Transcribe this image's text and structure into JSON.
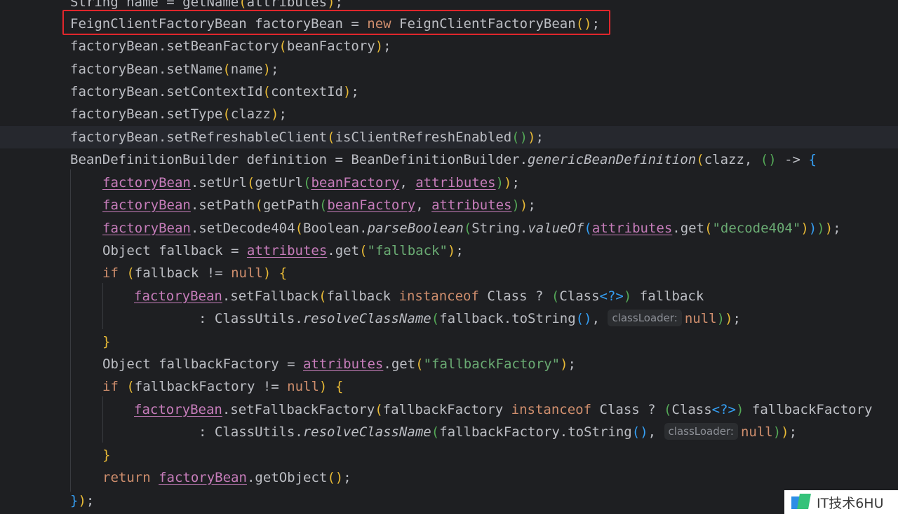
{
  "code": {
    "line0": "String name = getName(attributes);",
    "line1": "FeignClientFactoryBean factoryBean = new FeignClientFactoryBean();",
    "line2": "factoryBean.setBeanFactory(beanFactory);",
    "line3": "factoryBean.setName(name);",
    "line4": "factoryBean.setContextId(contextId);",
    "line5": "factoryBean.setType(clazz);",
    "line6": "factoryBean.setRefreshableClient(isClientRefreshEnabled());",
    "line7": "BeanDefinitionBuilder definition = BeanDefinitionBuilder.genericBeanDefinition(clazz, () -> {",
    "line8": "factoryBean.setUrl(getUrl(beanFactory, attributes));",
    "line9": "factoryBean.setPath(getPath(beanFactory, attributes));",
    "line10": "factoryBean.setDecode404(Boolean.parseBoolean(String.valueOf(attributes.get(\"decode404\"))));",
    "line11": "Object fallback = attributes.get(\"fallback\");",
    "line12": "if (fallback != null) {",
    "line13": "factoryBean.setFallback(fallback instanceof Class ? (Class<?>) fallback",
    "line14": ": ClassUtils.resolveClassName(fallback.toString(), classLoader: null));",
    "line15": "}",
    "line16": "Object fallbackFactory = attributes.get(\"fallbackFactory\");",
    "line17": "if (fallbackFactory != null) {",
    "line18": "factoryBean.setFallbackFactory(fallbackFactory instanceof Class ? (Class<?>) fallbackFactory",
    "line19": ": ClassUtils.resolveClassName(fallbackFactory.toString(), classLoader: null));",
    "line20": "}",
    "line21": "return factoryBean.getObject();",
    "line22": "});"
  },
  "hints": {
    "classLoader": "classLoader:"
  },
  "highlight_color": "#e0262c",
  "watermark": {
    "text": "IT技术6HU",
    "logo_icon": "book-logo-icon"
  }
}
